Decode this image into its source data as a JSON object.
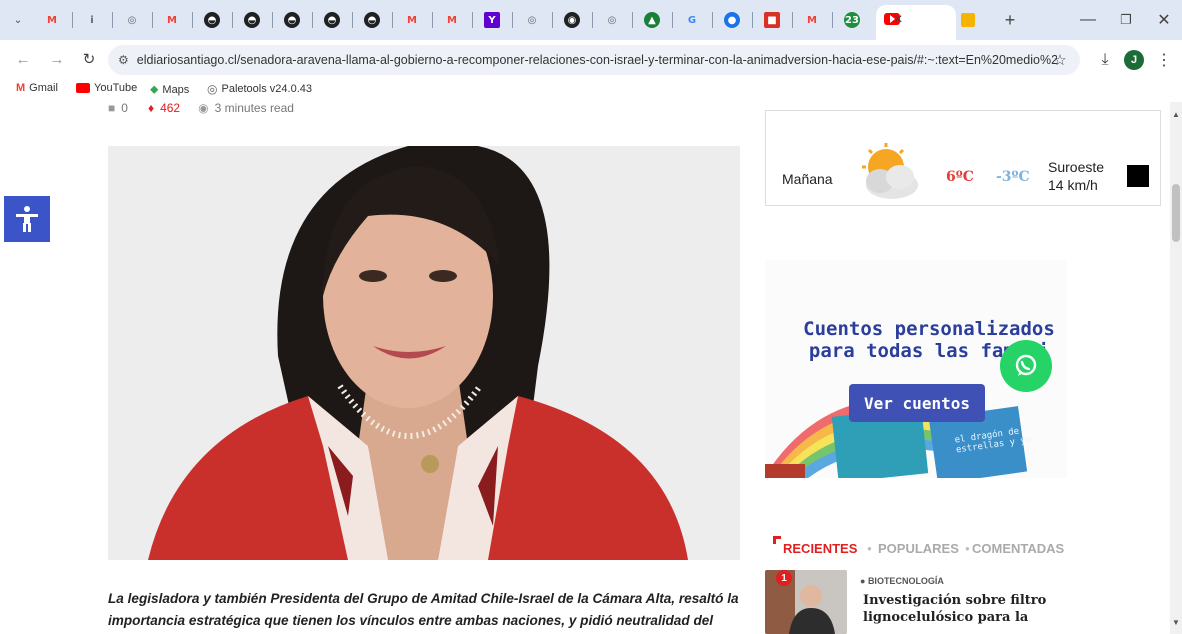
{
  "browser": {
    "tabs": [
      {
        "icon": "chevron-down",
        "color": "#5f6368",
        "glyph": "⌄"
      },
      {
        "icon": "gmail",
        "color": "#ea4335",
        "glyph": "M"
      },
      {
        "icon": "info",
        "color": "#5f6368",
        "glyph": "i"
      },
      {
        "icon": "globe",
        "color": "#5f6368",
        "glyph": "◎"
      },
      {
        "icon": "gmail",
        "color": "#ea4335",
        "glyph": "M"
      },
      {
        "icon": "chatgpt",
        "color": "#202124",
        "glyph": "◓"
      },
      {
        "icon": "chatgpt",
        "color": "#202124",
        "glyph": "◓"
      },
      {
        "icon": "chatgpt",
        "color": "#202124",
        "glyph": "◓"
      },
      {
        "icon": "chatgpt",
        "color": "#202124",
        "glyph": "◓"
      },
      {
        "icon": "chatgpt",
        "color": "#202124",
        "glyph": "◓"
      },
      {
        "icon": "gmail",
        "color": "#ea4335",
        "glyph": "M"
      },
      {
        "icon": "gmail",
        "color": "#ea4335",
        "glyph": "M"
      },
      {
        "icon": "yahoo",
        "color": "#6001d2",
        "glyph": "Y"
      },
      {
        "icon": "globe",
        "color": "#5f6368",
        "glyph": "◎"
      },
      {
        "icon": "github",
        "color": "#202124",
        "glyph": "◉"
      },
      {
        "icon": "globe",
        "color": "#5f6368",
        "glyph": "◎"
      },
      {
        "icon": "drive",
        "color": "#188038",
        "glyph": "▲"
      },
      {
        "icon": "google",
        "color": "#4285f4",
        "glyph": "G"
      },
      {
        "icon": "chat",
        "color": "#1a73e8",
        "glyph": "●"
      },
      {
        "icon": "flag",
        "color": "#d93025",
        "glyph": "■"
      },
      {
        "icon": "gmail",
        "color": "#ea4335",
        "glyph": "M"
      },
      {
        "icon": "whatsapp-badge",
        "color": "#1e8e3e",
        "glyph": "23"
      }
    ],
    "active_tab_close": "×",
    "new_tab": "+",
    "url": "eldiariosantiago.cl/senadora-aravena-llama-al-gobierno-a-recomponer-relaciones-con-israel-y-terminar-con-la-animadversion-hacia-ese-pais/#:~:text=En%20medio%2...",
    "profile_initial": "J",
    "bookmarks": [
      {
        "label": "Gmail",
        "icon": "gmail-icon",
        "color": "#ea4335"
      },
      {
        "label": "YouTube",
        "icon": "youtube-icon",
        "color": "#ff0000"
      },
      {
        "label": "Maps",
        "icon": "maps-icon",
        "color": "#34a853"
      },
      {
        "label": "Paletools v24.0.43",
        "icon": "globe-icon",
        "color": "#5f6368"
      }
    ]
  },
  "article": {
    "meta": {
      "comments": "0",
      "hot": "462",
      "read_time": "3 minutes read"
    },
    "lead": "La legisladora y también Presidenta del Grupo de Amitad Chile-Israel de la Cámara Alta, resaltó la importancia estratégica que tienen los vínculos entre ambas naciones, y pidió neutralidad del"
  },
  "weather": {
    "day": "Mañana",
    "high": "6ºC",
    "low": "-3ºC",
    "wind_dir": "Suroeste",
    "wind_speed": "14 km/h"
  },
  "ad": {
    "title_line1": "Cuentos personalizados",
    "title_line2": "para todas las famili",
    "button": "Ver cuentos",
    "book_text": "el dragón de estrellas y yo"
  },
  "widget": {
    "tabs": [
      "RECIENTES",
      "POPULARES",
      "COMENTADAS"
    ],
    "item": {
      "badge": "1",
      "category": "BIOTECNOLOGÍA",
      "title": "Investigación sobre filtro lignocelulósico para la"
    }
  },
  "colors": {
    "accent": "#e02020",
    "whatsapp": "#25d366",
    "accessibility": "#3b55c9",
    "ad_button": "#3f51b5",
    "ad_title": "#2c3e9c"
  }
}
